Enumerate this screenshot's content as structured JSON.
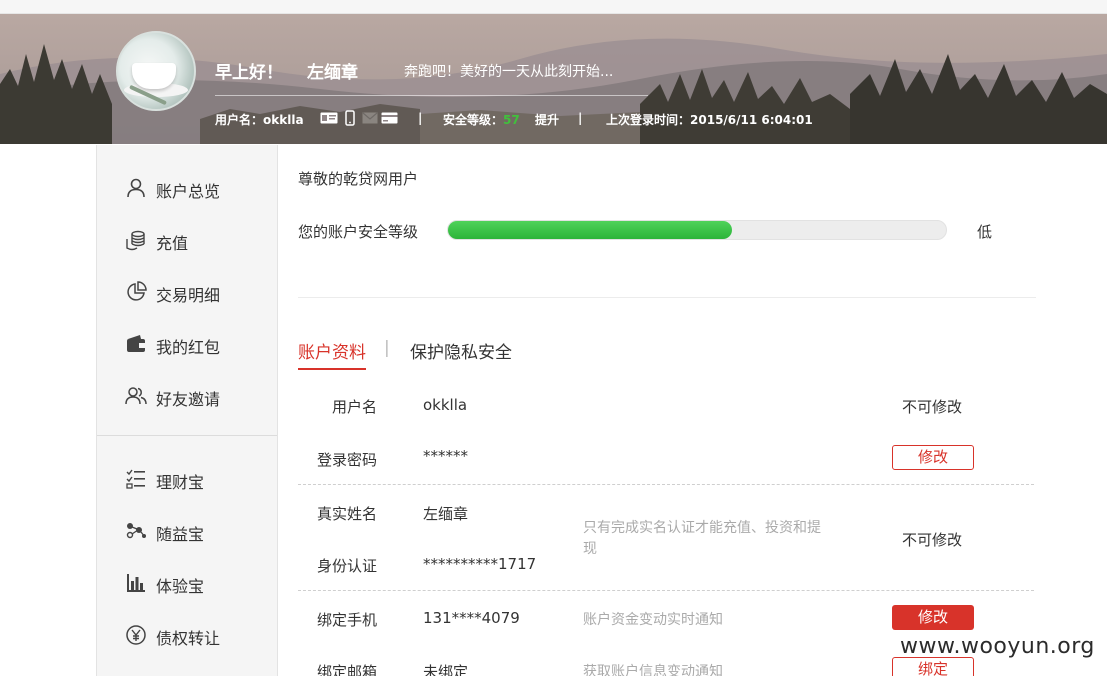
{
  "header": {
    "greeting": "早上好！",
    "display_name": "左缅章",
    "slogan": "奔跑吧！美好的一天从此刻开始...",
    "username_label": "用户名：",
    "username": "okklla",
    "security_level_label": "安全等级：",
    "security_level_value": "57",
    "upgrade_link": "提升",
    "separator": "|",
    "last_login_label": "上次登录时间：",
    "last_login_time": "2015/6/11 6:04:01"
  },
  "sidebar": {
    "items": [
      {
        "label": "账户总览",
        "icon": "user-icon"
      },
      {
        "label": "充值",
        "icon": "coins-icon"
      },
      {
        "label": "交易明细",
        "icon": "pie-chart-icon"
      },
      {
        "label": "我的红包",
        "icon": "wallet-icon"
      },
      {
        "label": "好友邀请",
        "icon": "friends-icon"
      },
      {
        "label": "理财宝",
        "icon": "list-icon"
      },
      {
        "label": "随益宝",
        "icon": "nodes-icon"
      },
      {
        "label": "体验宝",
        "icon": "bar-chart-icon"
      },
      {
        "label": "债权转让",
        "icon": "yen-icon"
      }
    ]
  },
  "main": {
    "title": "尊敬的乾贷网用户",
    "security_label": "您的账户安全等级",
    "security_progress": 0.57,
    "security_rating": "低",
    "tabs": [
      {
        "label": "账户资料",
        "active": true
      },
      {
        "label": "保护隐私安全",
        "active": false
      }
    ],
    "tab_separator": "|",
    "rows": {
      "username": {
        "label": "用户名",
        "value": "okklla",
        "status": "不可修改"
      },
      "password": {
        "label": "登录密码",
        "value": "******",
        "action": "修改"
      },
      "realname": {
        "label": "真实姓名",
        "value": "左缅章"
      },
      "idcard": {
        "label": "身份认证",
        "value": "**********1717"
      },
      "realname_note": "只有完成实名认证才能充值、投资和提现",
      "realname_status": "不可修改",
      "phone": {
        "label": "绑定手机",
        "value": "131****4079",
        "note": "账户资金变动实时通知",
        "action": "修改"
      },
      "email": {
        "label": "绑定邮箱",
        "value": "未绑定",
        "note": "获取账户信息变动通知",
        "action": "绑定"
      }
    }
  },
  "watermark": "www.wooyun.org",
  "colors": {
    "accent": "#d8332a",
    "progress": "#2cb439",
    "sidebar_bg": "#f5f5f5"
  }
}
